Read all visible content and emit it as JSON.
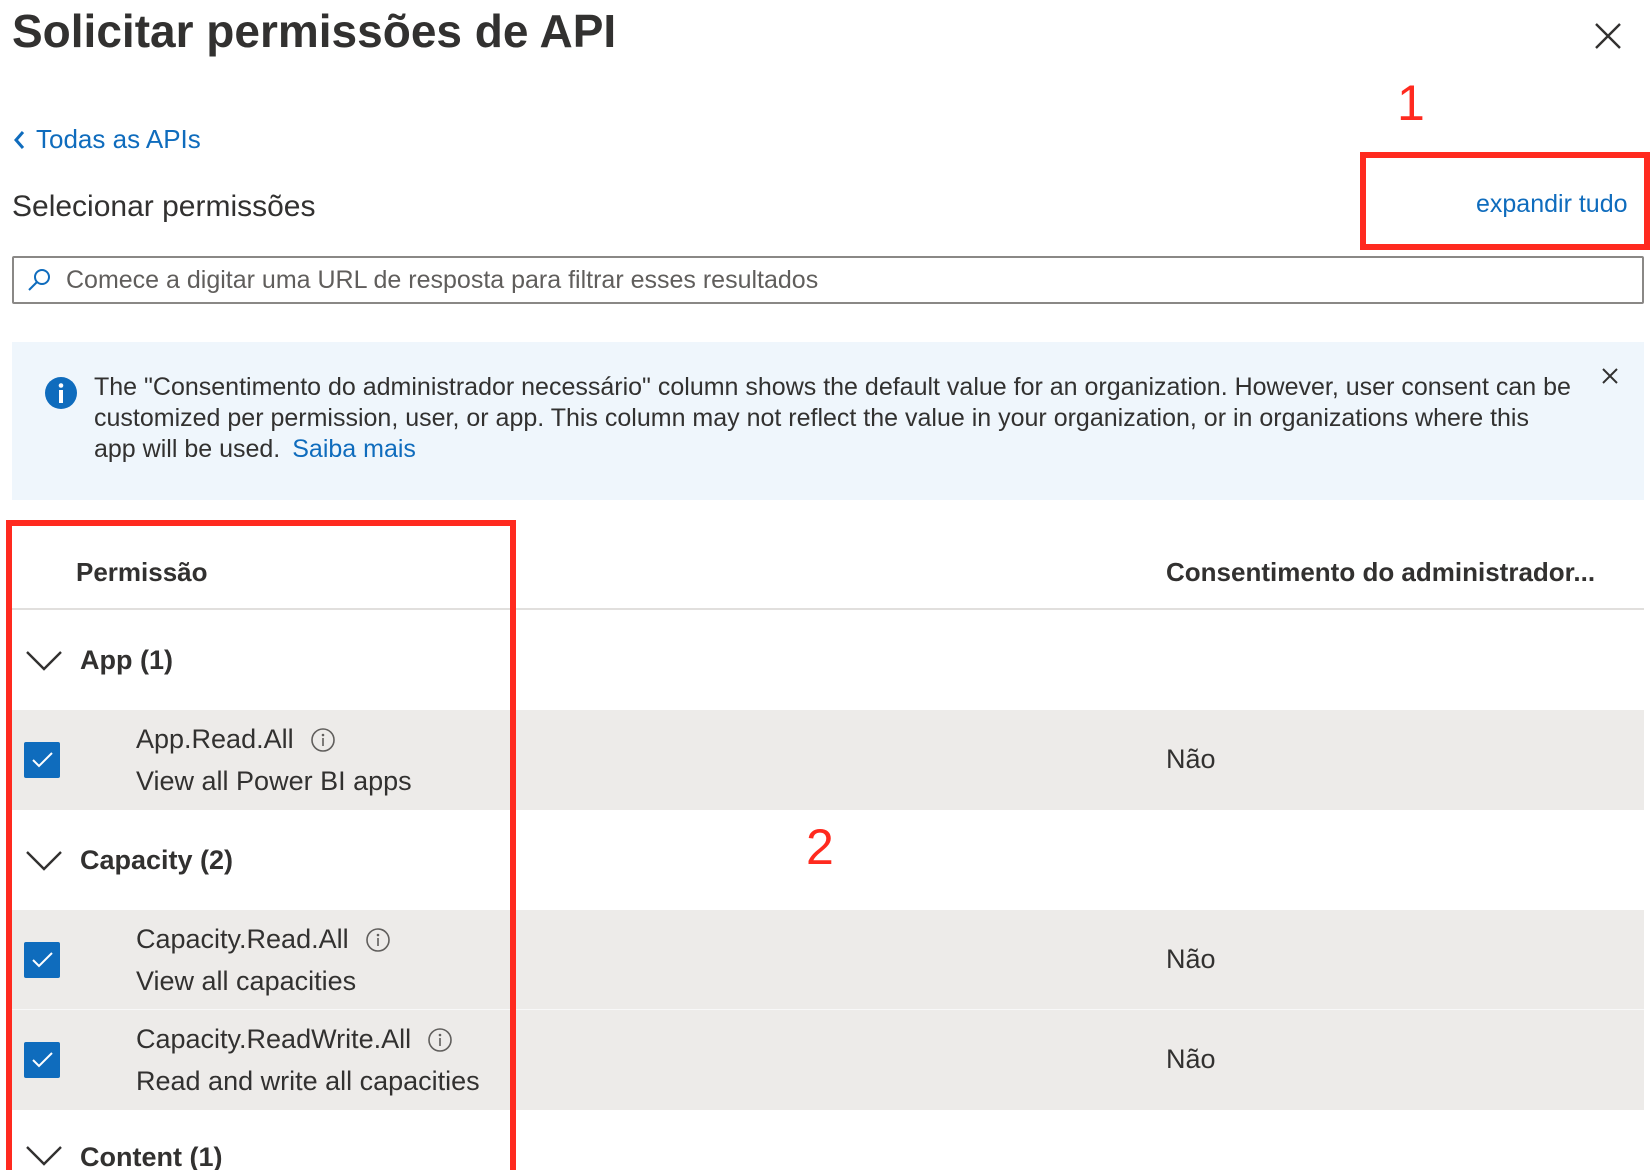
{
  "panel": {
    "title": "Solicitar permissões de API",
    "back_link": "Todas as APIs",
    "section_title": "Selecionar permissões",
    "expand_all": "expandir tudo"
  },
  "search": {
    "placeholder": "Comece a digitar uma URL de resposta para filtrar esses resultados"
  },
  "info_bar": {
    "text": "The \"Consentimento do administrador necessário\" column shows the default value for an organization. However, user consent can be customized per permission, user, or app. This column may not reflect the value in your organization, or in organizations where this app will be used.",
    "link": "Saiba mais"
  },
  "table": {
    "headers": {
      "permission": "Permissão",
      "admin_consent": "Consentimento do administrador..."
    },
    "groups": [
      {
        "label": "App (1)",
        "items": [
          {
            "name": "App.Read.All",
            "description": "View all Power BI apps",
            "consent": "Não",
            "checked": true
          }
        ]
      },
      {
        "label": "Capacity (2)",
        "items": [
          {
            "name": "Capacity.Read.All",
            "description": "View all capacities",
            "consent": "Não",
            "checked": true
          },
          {
            "name": "Capacity.ReadWrite.All",
            "description": "Read and write all capacities",
            "consent": "Não",
            "checked": true
          }
        ]
      },
      {
        "label": "Content (1)",
        "items": []
      }
    ]
  },
  "annotations": {
    "marker_1": "1",
    "marker_2": "2",
    "color": "#ff2a1f"
  },
  "colors": {
    "accent": "#0f6cbd",
    "info_background": "#eff6fc",
    "selected_row": "#edebe9"
  }
}
